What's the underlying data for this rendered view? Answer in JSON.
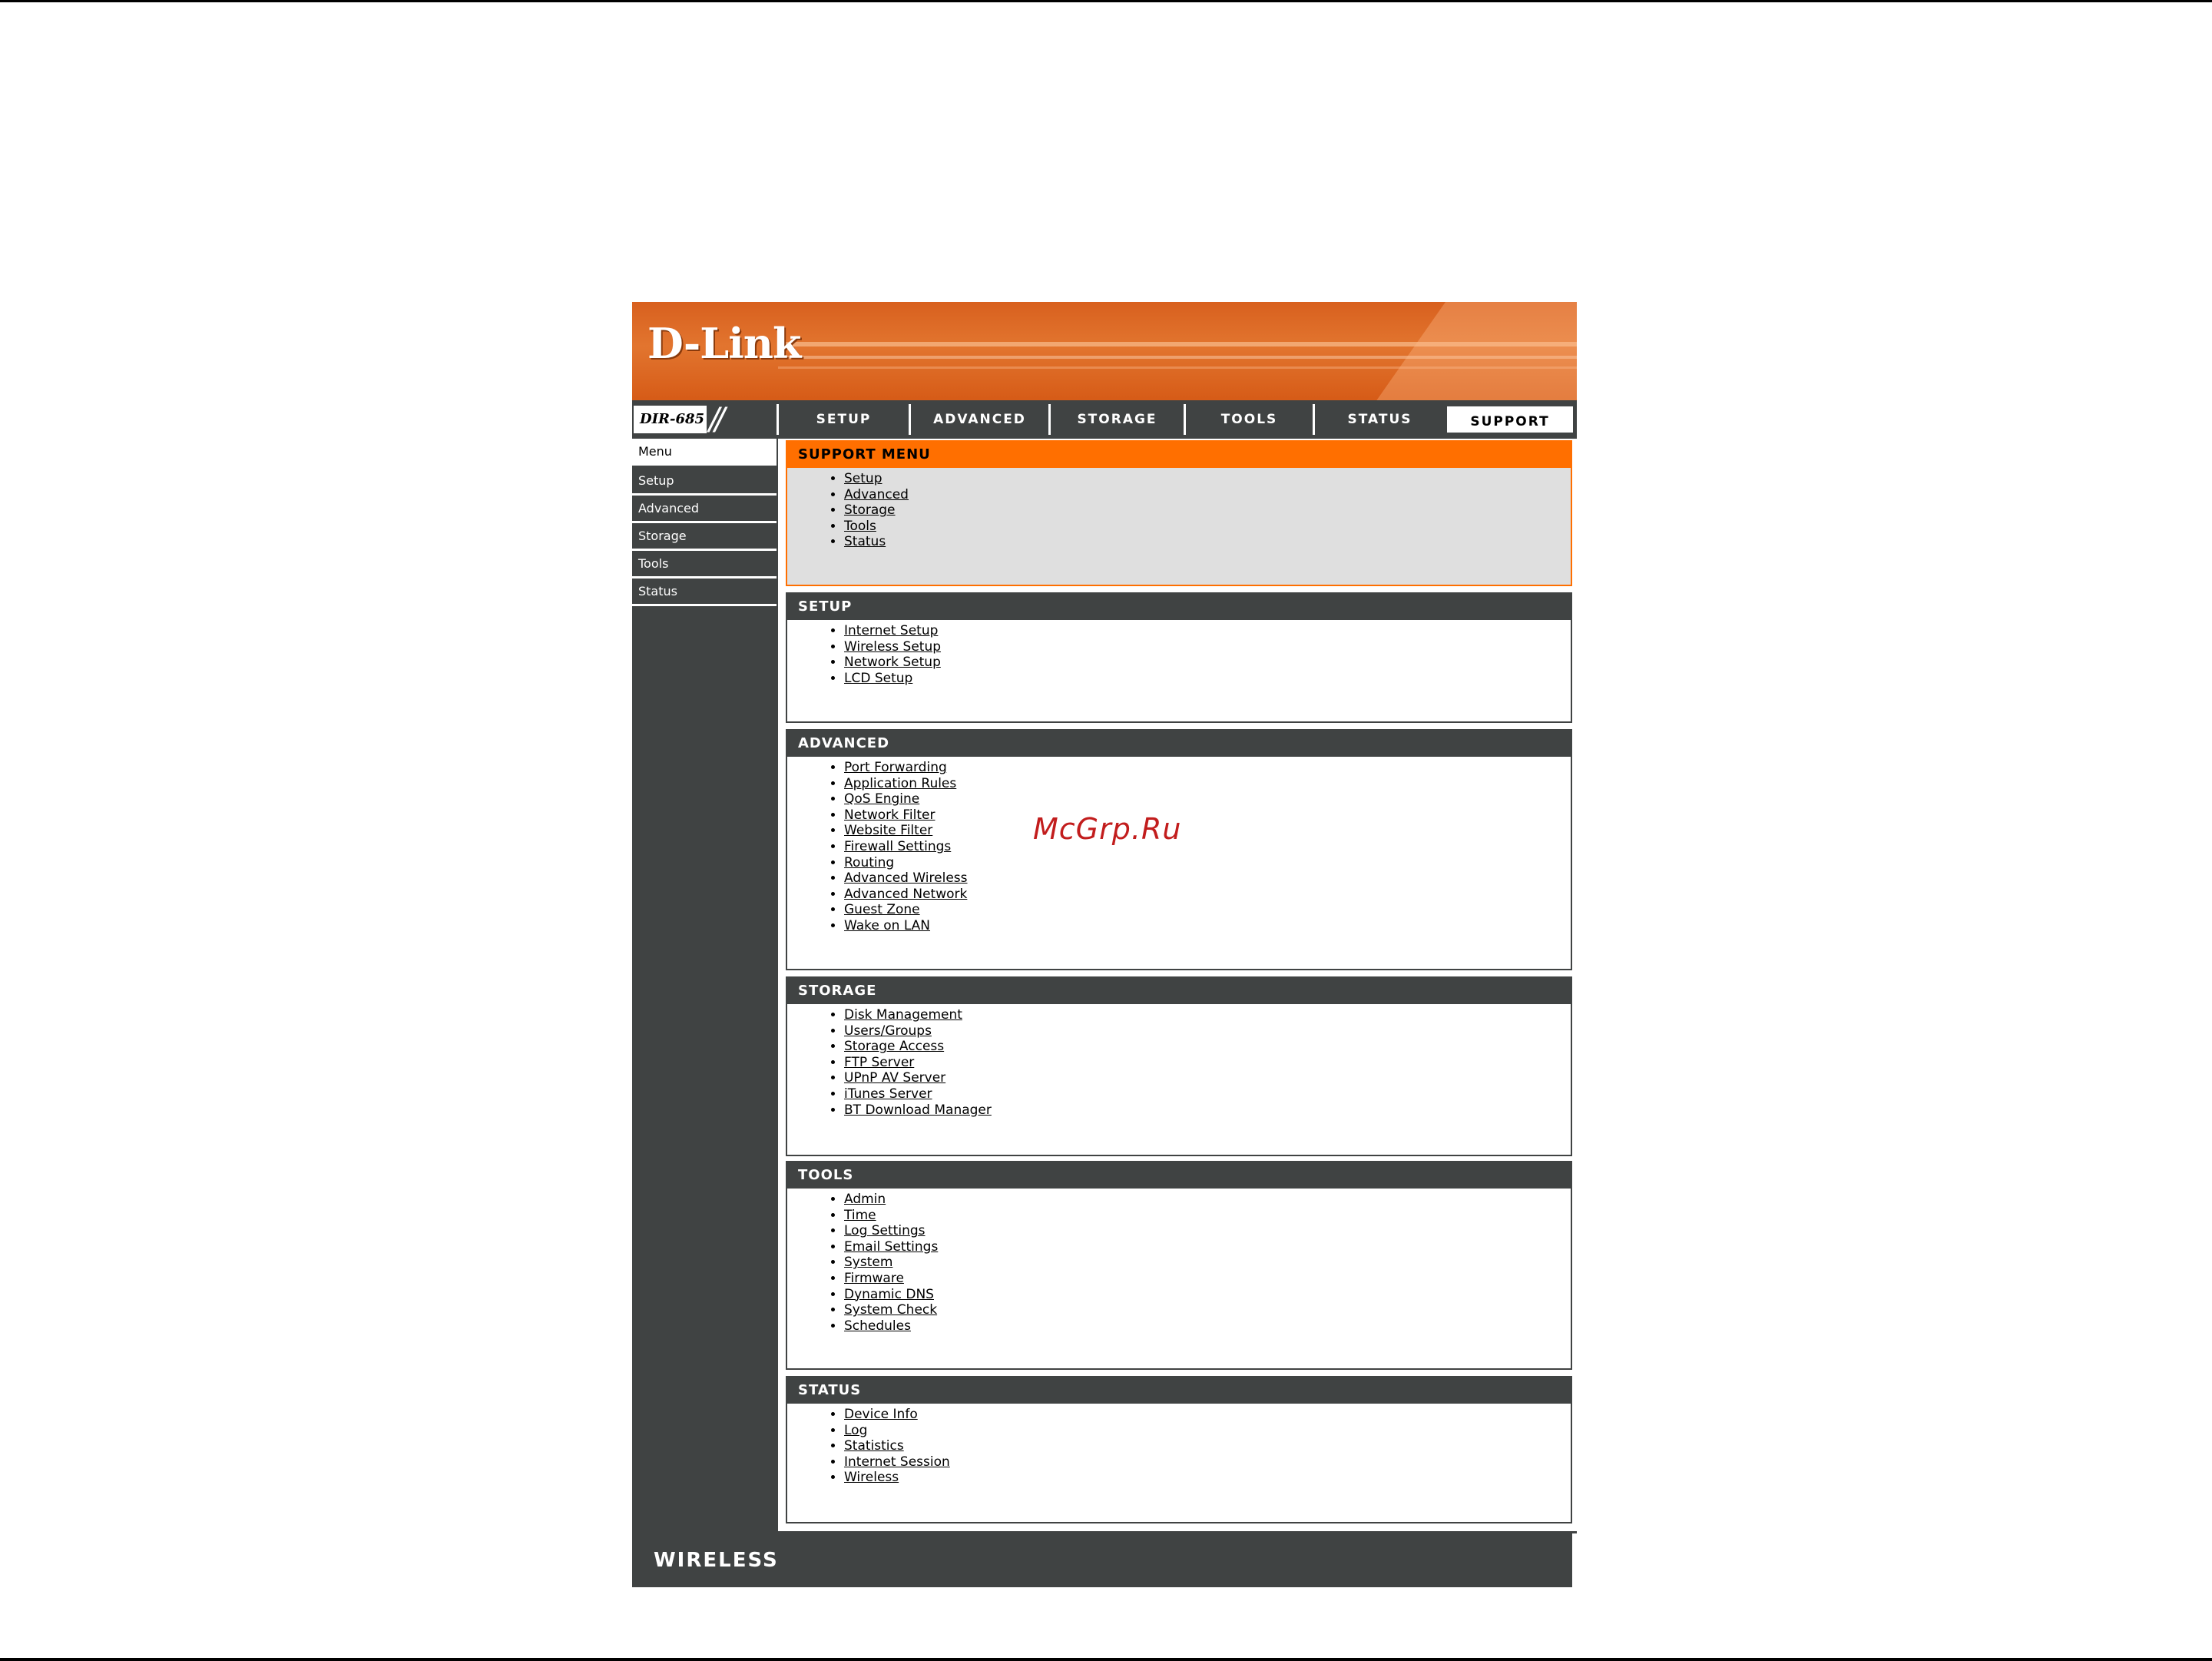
{
  "brand": {
    "logo": "D-Link",
    "model": "DIR-685",
    "footer_label": "WIRELESS"
  },
  "nav": {
    "tabs": [
      "SETUP",
      "ADVANCED",
      "STORAGE",
      "TOOLS",
      "STATUS",
      "SUPPORT"
    ],
    "active": "SUPPORT"
  },
  "sidebar": {
    "items": [
      "Menu",
      "Setup",
      "Advanced",
      "Storage",
      "Tools",
      "Status"
    ],
    "active": "Menu"
  },
  "sections": {
    "support": {
      "title": "SUPPORT MENU",
      "links": [
        "Setup",
        "Advanced",
        "Storage",
        "Tools",
        "Status"
      ]
    },
    "setup": {
      "title": "SETUP",
      "links": [
        "Internet Setup",
        "Wireless Setup",
        "Network Setup",
        "LCD Setup"
      ]
    },
    "advanced": {
      "title": "ADVANCED",
      "links": [
        "Port Forwarding",
        "Application Rules",
        "QoS Engine",
        "Network Filter",
        "Website Filter",
        "Firewall Settings",
        "Routing",
        "Advanced Wireless",
        "Advanced Network",
        "Guest Zone",
        "Wake on LAN"
      ]
    },
    "storage": {
      "title": "STORAGE",
      "links": [
        "Disk Management",
        "Users/Groups",
        "Storage Access",
        "FTP Server",
        "UPnP AV Server",
        "iTunes Server",
        "BT Download Manager"
      ]
    },
    "tools": {
      "title": "TOOLS",
      "links": [
        "Admin",
        "Time",
        "Log Settings",
        "Email Settings",
        "System",
        "Firmware",
        "Dynamic DNS",
        "System Check",
        "Schedules"
      ]
    },
    "status": {
      "title": "STATUS",
      "links": [
        "Device Info",
        "Log",
        "Statistics",
        "Internet Session",
        "Wireless"
      ]
    }
  },
  "watermark": "McGrp.Ru",
  "colors": {
    "accent": "#ff6f00",
    "dark": "#404343",
    "header": "#e2752f",
    "watermark": "#c21d1d"
  }
}
